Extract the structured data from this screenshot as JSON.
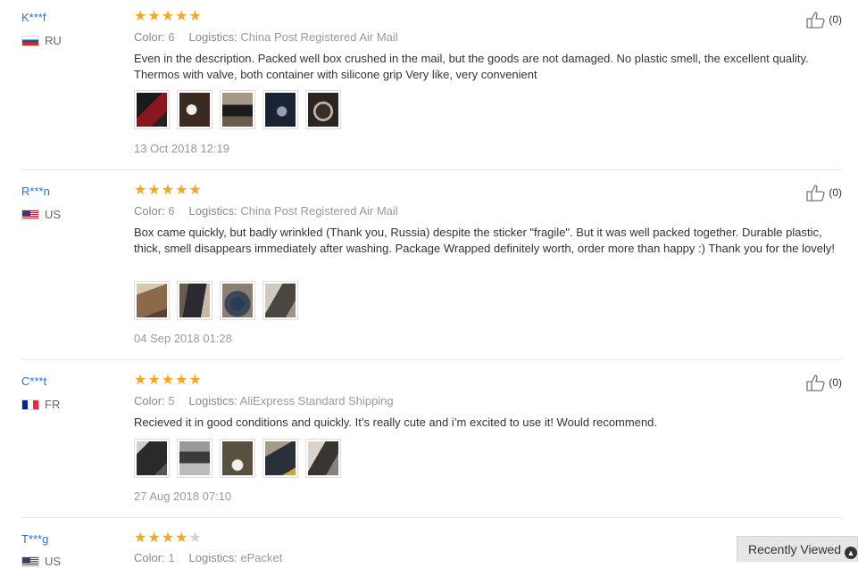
{
  "reviews": [
    {
      "user": "K***f",
      "country": "RU",
      "flag": "ru",
      "rating": 5,
      "color_label": "Color:",
      "color_value": "6",
      "logistics_label": "Logistics:",
      "logistics_value": "China Post Registered Air Mail",
      "text": "Even in the description. Packed well box crushed in the mail, but the goods are not damaged. No plastic smell, the excellent quality. Thermos with valve, both container with silicone grip Very like, very convenient",
      "photos": [
        "#8a1620",
        "#3a2a22",
        "#6b5b4b",
        "#1a2233",
        "#2c2420"
      ],
      "date": "13 Oct 2018 12:19",
      "likes": "(0)"
    },
    {
      "user": "R***n",
      "country": "US",
      "flag": "us",
      "rating": 5,
      "color_label": "Color:",
      "color_value": "6",
      "logistics_label": "Logistics:",
      "logistics_value": "China Post Registered Air Mail",
      "text": "Box came quickly, but badly wrinkled (Thank you, Russia) despite the sticker \"fragile\". But it was well packed together. Durable plastic, thick, smell disappears immediately after washing. Package Wrapped definitely worth, order more than happy :) Thank you for the lovely!",
      "photos": [
        "#8b6a4a",
        "#2a2a30",
        "#3b4656",
        "#4a4640"
      ],
      "date": "04 Sep 2018 01:28",
      "likes": "(0)"
    },
    {
      "user": "C***t",
      "country": "FR",
      "flag": "fr",
      "rating": 5,
      "color_label": "Color:",
      "color_value": "5",
      "logistics_label": "Logistics:",
      "logistics_value": "AliExpress Standard Shipping",
      "text": "Recieved it in good conditions and quickly. It’s really cute and i’m excited to use it! Would recommend.",
      "photos": [
        "#2a2a2a",
        "#3a3a3a",
        "#5a5040",
        "#2a2f3a",
        "#3a3530"
      ],
      "date": "27 Aug 2018 07:10",
      "likes": "(0)"
    },
    {
      "user": "T***g",
      "country": "US",
      "flag": "us",
      "rating": 4,
      "color_label": "Color:",
      "color_value": "1",
      "logistics_label": "Logistics:",
      "logistics_value": "ePacket",
      "likes": "(0)"
    }
  ],
  "recently_viewed": "Recently Viewed",
  "icons": {
    "like": "thumbs-up-icon",
    "star": "star-icon",
    "expand": "chevron-up-icon"
  }
}
